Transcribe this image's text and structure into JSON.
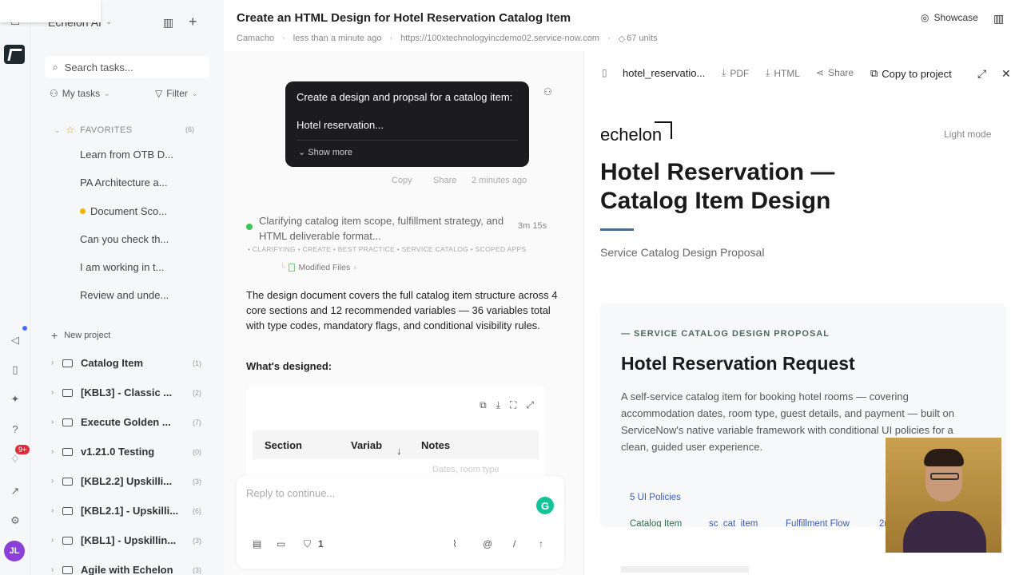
{
  "sidebar": {
    "app_title": "Echelon AI",
    "search_placeholder": "Search tasks...",
    "my_tasks": "My tasks",
    "filter": "Filter",
    "favorites_label": "FAVORITES",
    "favorites_count": "(6)",
    "favorites": [
      {
        "label": "Learn from OTB D..."
      },
      {
        "label": "PA Architecture a..."
      },
      {
        "label": "Document Sco..."
      },
      {
        "label": "Can you check th..."
      },
      {
        "label": "I am working in t..."
      },
      {
        "label": "Review and unde..."
      }
    ],
    "new_project": "New project",
    "projects": [
      {
        "label": "Catalog Item",
        "count": "(1)"
      },
      {
        "label": "[KBL3] - Classic ...",
        "count": "(2)"
      },
      {
        "label": "Execute Golden ...",
        "count": "(7)"
      },
      {
        "label": "v1.21.0 Testing",
        "count": "(0)"
      },
      {
        "label": "[KBL2.2] Upskilli...",
        "count": "(3)"
      },
      {
        "label": "[KBL2.1] - Upskilli...",
        "count": "(6)"
      },
      {
        "label": "[KBL1] - Upskillin...",
        "count": "(3)"
      },
      {
        "label": "Agile with Echelon",
        "count": "(3)"
      }
    ],
    "notification_badge": "9+",
    "avatar_initials": "JL"
  },
  "header": {
    "title": "Create an HTML Design for Hotel Reservation Catalog Item",
    "meta_user": "Camacho",
    "meta_time": "less than a minute ago",
    "meta_url": "https://100xtechnologyincdemo02.service-now.com",
    "meta_units": "67 units",
    "showcase": "Showcase"
  },
  "chat": {
    "user_msg_line1": "Create a design and propsal for a catalog item:",
    "user_msg_line2": "Hotel reservation...",
    "show_more": "Show more",
    "copy": "Copy",
    "share": "Share",
    "msg_time": "2 minutes ago",
    "step_text": "Clarifying catalog item scope, fulfillment strategy, and HTML deliverable format...",
    "step_time": "3m 15s",
    "step_tags": "• CLARIFYING  • CREATE  • BEST PRACTICE  • SERVICE CATALOG  • SCOPED APPS",
    "modified_files": "Modified Files",
    "body": "The design document covers the full catalog item structure across 4 core sections and 12 recommended variables — 36 variables total with type codes, mandatory flags, and conditional visibility rules.",
    "designed_heading": "What's designed:",
    "table_cols": [
      "Section",
      "Variab",
      "Notes"
    ],
    "table_faded": "Dates, room type",
    "reply_placeholder": "Reply to continue...",
    "shield_count": "1"
  },
  "preview": {
    "filename": "hotel_reservatio...",
    "pdf": "PDF",
    "html": "HTML",
    "share": "Share",
    "copy_to_project": "Copy to project",
    "logo": "echelon",
    "light_mode": "Light mode",
    "h1": "Hotel Reservation — Catalog Item Design",
    "subtitle": "Service Catalog Design Proposal",
    "card_eyebrow": "— SERVICE CATALOG DESIGN PROPOSAL",
    "card_title": "Hotel Reservation Request",
    "card_desc": "A self-service catalog item for booking hotel rooms — covering accommodation dates, room type, guest details, and payment — built on ServiceNow's native variable framework with conditional UI policies for a clean, guided user experience.",
    "chips": [
      "Catalog Item",
      "sc_cat_item",
      "Fulfillment Flow",
      "2(",
      "5 UI Policies"
    ]
  }
}
